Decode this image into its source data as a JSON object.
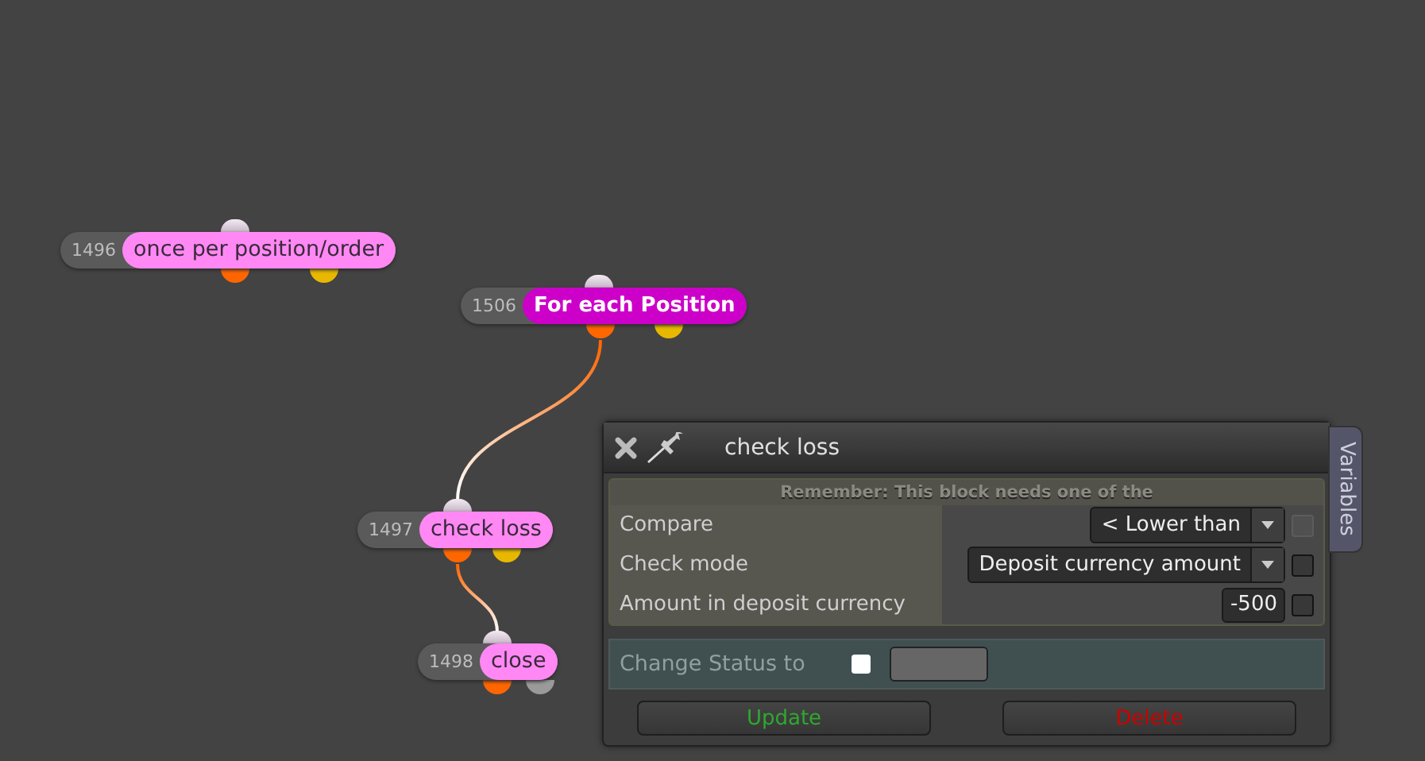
{
  "canvas": {
    "nodes": [
      {
        "id": "1496",
        "label": "once per position/order",
        "selected": false,
        "outputs": [
          {
            "color": "#ff6600"
          },
          {
            "color": "#e8b800"
          }
        ]
      },
      {
        "id": "1506",
        "label": "For each Position",
        "selected": true,
        "outputs": [
          {
            "color": "#ff6600"
          },
          {
            "color": "#e8b800"
          }
        ],
        "children": [
          {
            "id": "1497",
            "label": "check loss",
            "selected": false,
            "outputs": [
              {
                "color": "#ff6600"
              },
              {
                "color": "#e8b800"
              }
            ],
            "children": [
              {
                "id": "1498",
                "label": "close",
                "selected": false,
                "outputs": [
                  {
                    "color": "#ff6600"
                  },
                  {
                    "color": "#9a9a9a"
                  }
                ]
              }
            ]
          }
        ]
      }
    ]
  },
  "panel": {
    "title": "check loss",
    "side_tab": "Variables",
    "notice": "Remember: This block needs one of the",
    "fields": [
      {
        "label": "Compare",
        "kind": "dropdown",
        "value": "< Lower than",
        "checked": false,
        "disabled": true
      },
      {
        "label": "Check mode",
        "kind": "dropdown",
        "value": "Deposit currency amount",
        "checked": false,
        "disabled": false
      },
      {
        "label": "Amount in deposit currency",
        "kind": "number",
        "value": "-500",
        "checked": false,
        "disabled": false
      }
    ],
    "status": {
      "label": "Change Status to",
      "checked": false
    },
    "buttons": [
      {
        "label": "Update",
        "kind": "update"
      },
      {
        "label": "Delete",
        "kind": "delete"
      }
    ]
  }
}
